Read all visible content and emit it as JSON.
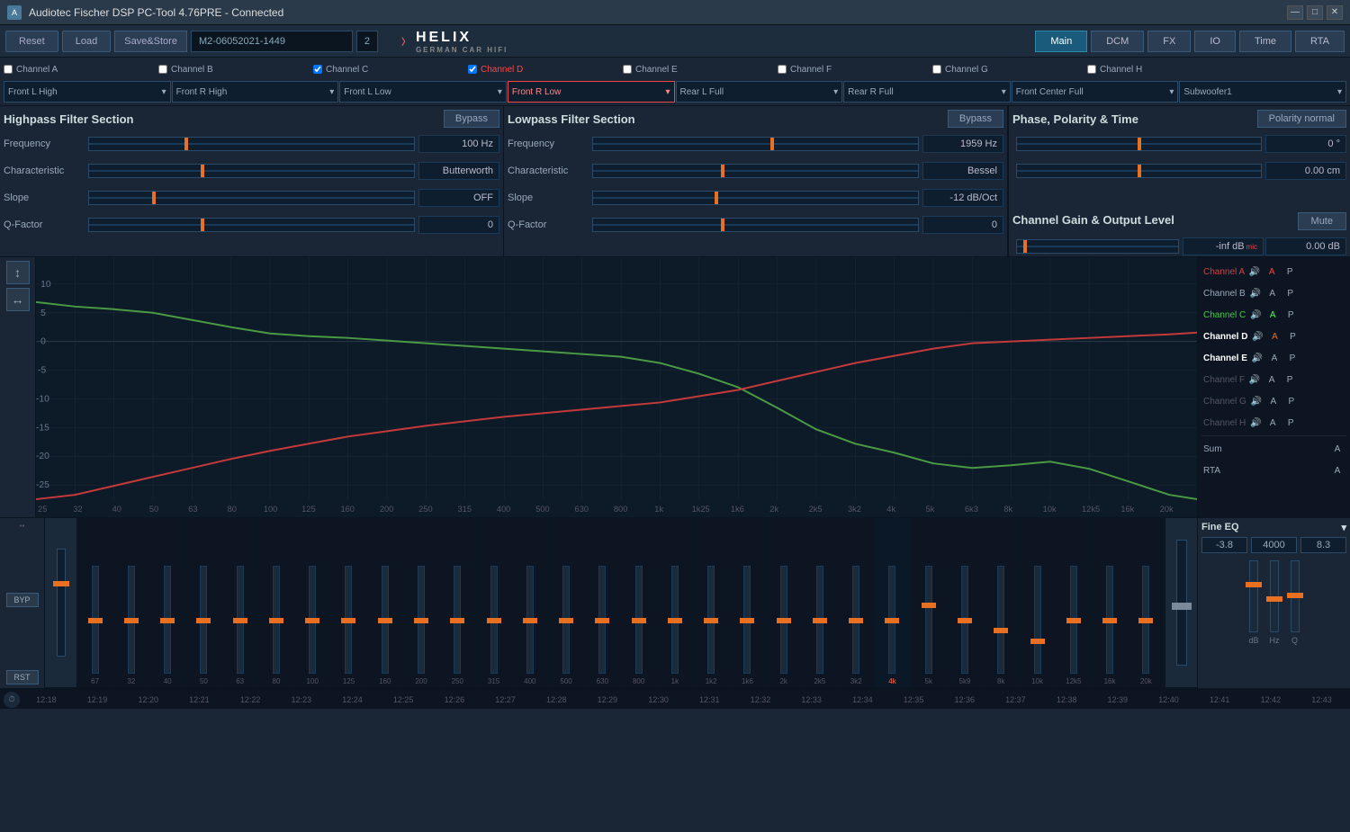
{
  "titlebar": {
    "title": "Audiotec Fischer DSP PC-Tool 4.76PRE - Connected",
    "icon": "A",
    "minimize": "—",
    "maximize": "□",
    "close": "✕"
  },
  "toolbar": {
    "reset_label": "Reset",
    "load_label": "Load",
    "save_label": "Save&Store",
    "preset_name": "M2-06052021-1449",
    "preset_num": "2",
    "nav": [
      "Main",
      "DCM",
      "FX",
      "IO",
      "Time",
      "RTA"
    ],
    "active_nav": "Main"
  },
  "channels": {
    "labels": [
      "Channel A",
      "Channel B",
      "Channel C",
      "Channel D",
      "Channel E",
      "Channel F",
      "Channel G",
      "Channel H"
    ],
    "active": "Channel D",
    "outputs": [
      "Front L High",
      "Front R High",
      "Front L Low",
      "Front R Low",
      "Rear L Full",
      "Rear R Full",
      "Front Center Full",
      "Subwoofer1"
    ]
  },
  "highpass": {
    "title": "Highpass Filter Section",
    "bypass_label": "Bypass",
    "frequency_label": "Frequency",
    "frequency_value": "100 Hz",
    "frequency_pct": 30,
    "characteristic_label": "Characteristic",
    "characteristic_value": "Butterworth",
    "characteristic_pct": 35,
    "slope_label": "Slope",
    "slope_value": "OFF",
    "slope_pct": 20,
    "qfactor_label": "Q-Factor",
    "qfactor_value": "0",
    "qfactor_pct": 35
  },
  "lowpass": {
    "title": "Lowpass Filter Section",
    "bypass_label": "Bypass",
    "frequency_label": "Frequency",
    "frequency_value": "1959 Hz",
    "frequency_pct": 55,
    "characteristic_label": "Characteristic",
    "characteristic_value": "Bessel",
    "characteristic_pct": 40,
    "slope_label": "Slope",
    "slope_value": "-12 dB/Oct",
    "slope_pct": 38,
    "qfactor_label": "Q-Factor",
    "qfactor_value": "0",
    "qfactor_pct": 40
  },
  "phase": {
    "title": "Phase, Polarity & Time",
    "polarity_label": "Polarity normal",
    "phase_value": "0 °",
    "phase_pct": 50,
    "time_value": "0.00 cm",
    "time_pct": 50
  },
  "gain": {
    "title": "Channel Gain & Output Level",
    "mute_label": "Mute",
    "level_db": "-inf dB",
    "level_db2": "0.00 dB",
    "level_pct": 5
  },
  "graph": {
    "y_axis": [
      "10",
      "5",
      "0",
      "-5",
      "-10",
      "-15",
      "-20",
      "-25"
    ],
    "x_axis": [
      "25",
      "32",
      "40",
      "50",
      "63",
      "80",
      "100",
      "125",
      "160",
      "200",
      "250",
      "315",
      "400",
      "500",
      "630",
      "800",
      "1k",
      "1k25",
      "1k6",
      "2k",
      "2k5",
      "3k2",
      "4k",
      "5k",
      "6k3",
      "8k",
      "10k",
      "12k5",
      "16k",
      "20k"
    ]
  },
  "channel_list": {
    "items": [
      {
        "name": "Channel A",
        "active": false,
        "has_p": true,
        "color": "red"
      },
      {
        "name": "Channel B",
        "active": false,
        "has_p": true,
        "color": "normal"
      },
      {
        "name": "Channel C",
        "active": false,
        "has_p": true,
        "color": "green"
      },
      {
        "name": "Channel D",
        "active": true,
        "has_p": true,
        "color": "orange"
      },
      {
        "name": "Channel E",
        "active": true,
        "has_p": true,
        "color": "normal"
      },
      {
        "name": "Channel F",
        "active": false,
        "has_p": true,
        "color": "normal"
      },
      {
        "name": "Channel G",
        "active": false,
        "has_p": true,
        "color": "normal"
      },
      {
        "name": "Channel H",
        "active": false,
        "has_p": true,
        "color": "normal"
      }
    ],
    "sum_label": "Sum",
    "rta_label": "RTA"
  },
  "eq": {
    "bands": [
      "67",
      "32",
      "40",
      "50",
      "63",
      "80",
      "100",
      "125",
      "160",
      "200",
      "250",
      "315",
      "400",
      "500",
      "630",
      "800",
      "1k",
      "1k2",
      "1k6",
      "2k",
      "2k5",
      "3k2",
      "4k",
      "5k",
      "5k9",
      "8k",
      "10k",
      "12k5",
      "16k",
      "20k"
    ],
    "active_band": "4k",
    "byp_label": "BYP",
    "rst_label": "RST",
    "fader_positions": [
      50,
      50,
      50,
      50,
      50,
      50,
      50,
      50,
      50,
      50,
      50,
      50,
      50,
      50,
      50,
      50,
      50,
      50,
      50,
      50,
      50,
      50,
      50,
      35,
      50,
      60,
      70,
      50,
      50,
      50
    ]
  },
  "fine_eq": {
    "title": "Fine EQ",
    "db_value": "-3.8",
    "hz_value": "4000",
    "q_value": "8.3",
    "label_db": "dB",
    "label_hz": "Hz",
    "label_q": "Q",
    "fader1_pct": 30,
    "fader2_pct": 50,
    "fader3_pct": 45
  },
  "timeline": {
    "times": [
      "12:18",
      "12:19",
      "12:20",
      "12:21",
      "12:22",
      "12:23",
      "12:24",
      "12:25",
      "12:26",
      "12:27",
      "12:28",
      "12:29",
      "12:30",
      "12:31",
      "12:32",
      "12:33",
      "12:34",
      "12:35",
      "12:36",
      "12:37",
      "12:38",
      "12:39",
      "12:40",
      "12:41",
      "12:42",
      "12:43"
    ]
  }
}
